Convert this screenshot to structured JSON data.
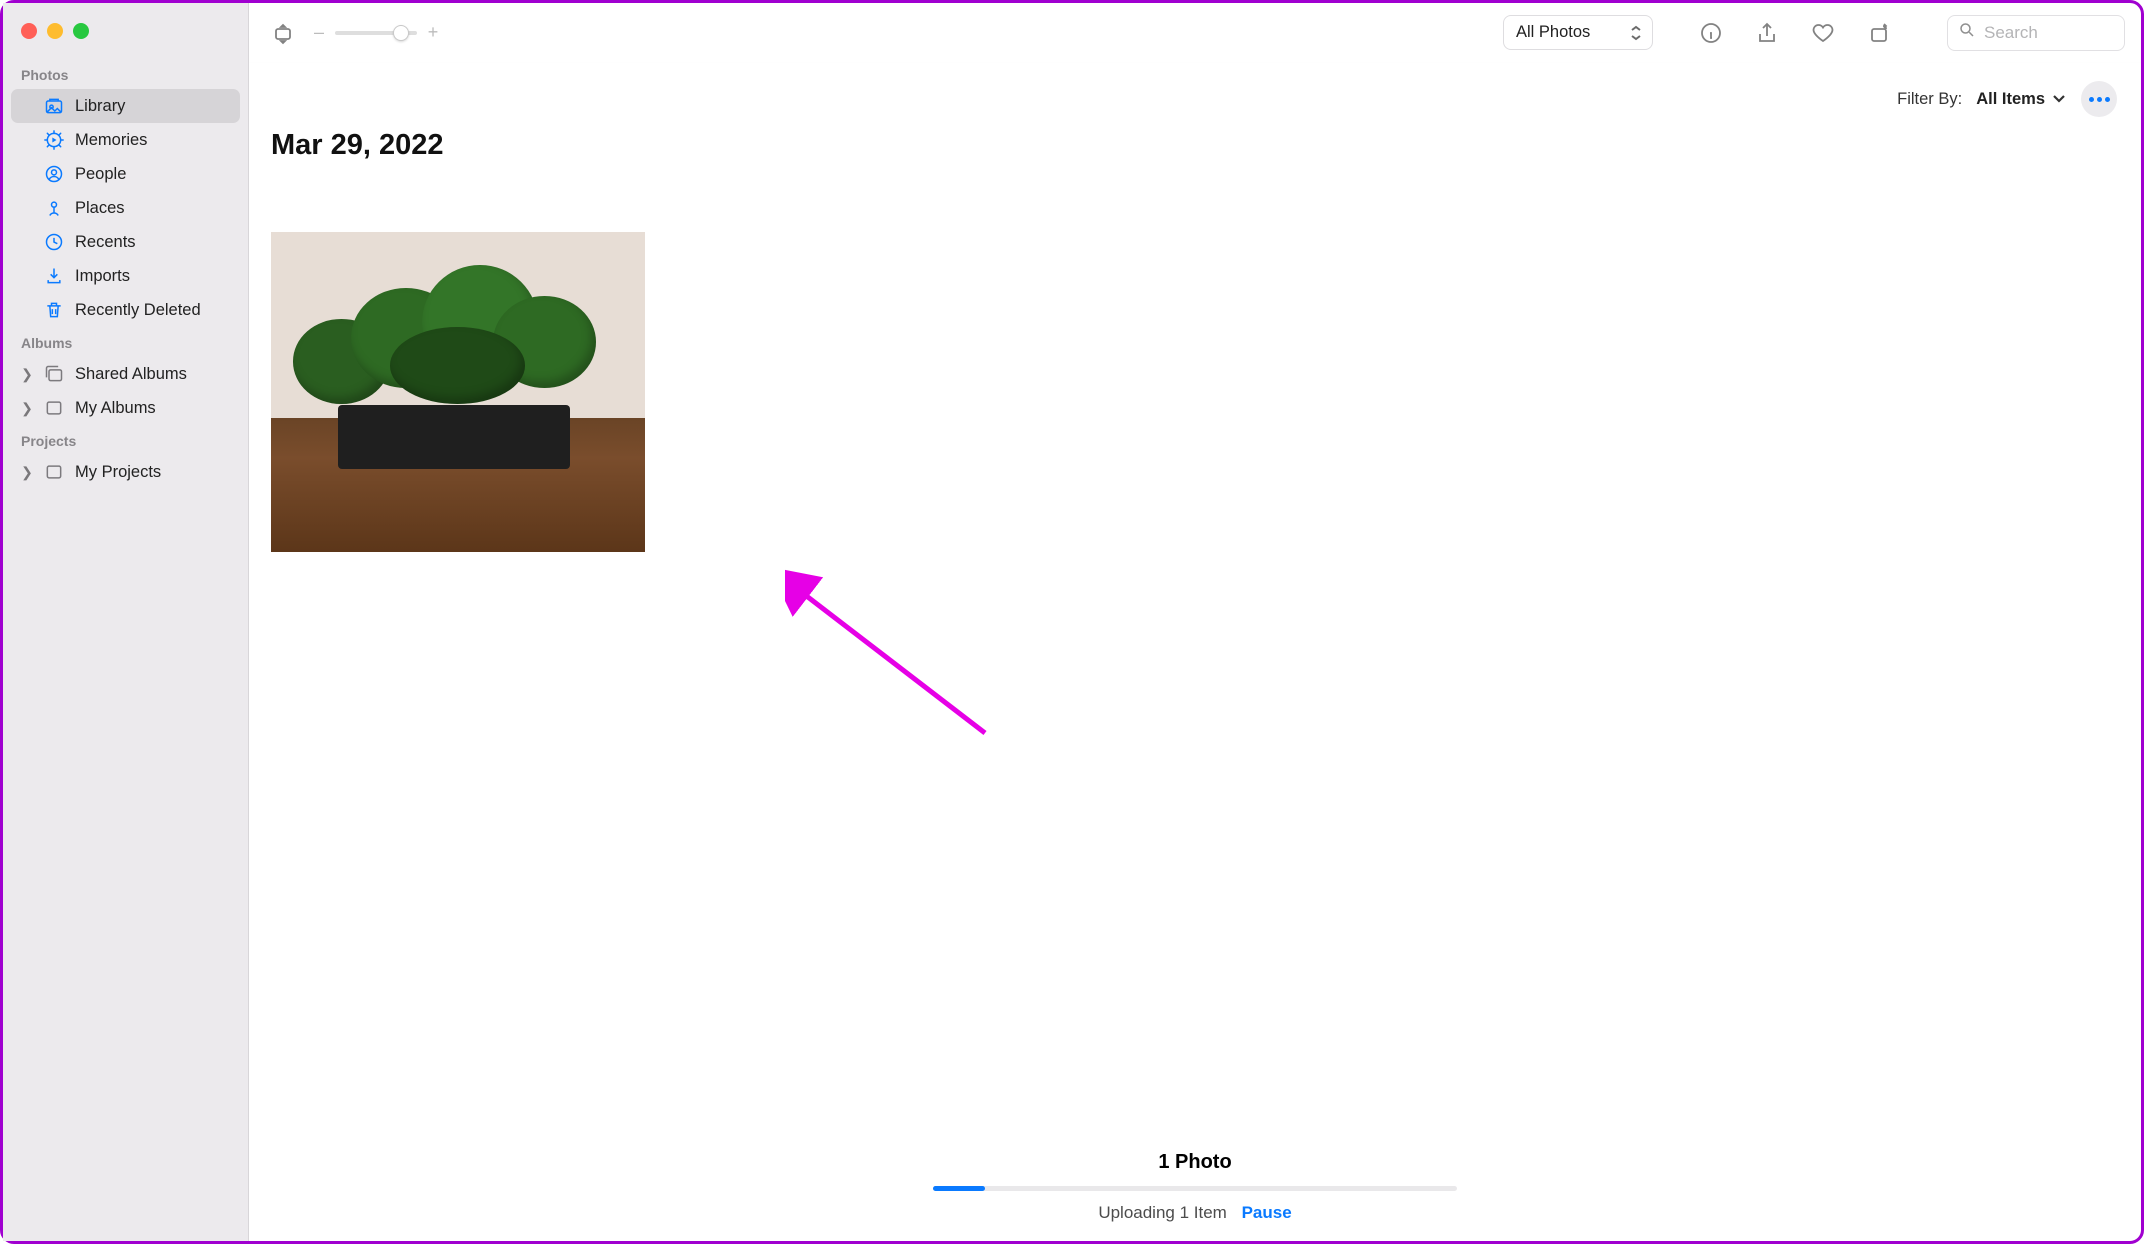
{
  "sidebar": {
    "sections": {
      "photos": "Photos",
      "albums": "Albums",
      "projects": "Projects"
    },
    "items": {
      "library": "Library",
      "memories": "Memories",
      "people": "People",
      "places": "Places",
      "recents": "Recents",
      "imports": "Imports",
      "recently_deleted": "Recently Deleted",
      "shared_albums": "Shared Albums",
      "my_albums": "My Albums",
      "my_projects": "My Projects"
    }
  },
  "toolbar": {
    "view_selector": "All Photos",
    "search_placeholder": "Search",
    "zoom_minus": "–",
    "zoom_plus": "+"
  },
  "filter": {
    "label": "Filter By:",
    "value": "All Items"
  },
  "content": {
    "date_heading": "Mar 29, 2022"
  },
  "status": {
    "count_label": "1 Photo",
    "upload_text": "Uploading 1 Item",
    "pause_label": "Pause",
    "progress_percent": 10
  },
  "colors": {
    "accent": "#0a7aff",
    "arrow": "#e600e6"
  }
}
